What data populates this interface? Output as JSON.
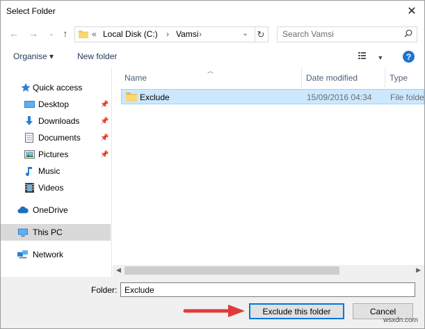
{
  "window": {
    "title": "Select Folder"
  },
  "address": {
    "prefix": "«",
    "crumbs": [
      "Local Disk (C:)",
      "Vamsi"
    ],
    "separator": "›"
  },
  "search": {
    "placeholder": "Search Vamsi"
  },
  "toolbar": {
    "organise": "Organise ▾",
    "new_folder": "New folder"
  },
  "nav": {
    "quick_access": "Quick access",
    "desktop": "Desktop",
    "downloads": "Downloads",
    "documents": "Documents",
    "pictures": "Pictures",
    "music": "Music",
    "videos": "Videos",
    "onedrive": "OneDrive",
    "this_pc": "This PC",
    "network": "Network"
  },
  "columns": {
    "name": "Name",
    "date": "Date modified",
    "type": "Type"
  },
  "files": [
    {
      "name": "Exclude",
      "date": "15/09/2016 04:34",
      "type": "File folder"
    }
  ],
  "bottom": {
    "folder_label": "Folder:",
    "folder_value": "Exclude",
    "confirm": "Exclude this folder",
    "cancel": "Cancel"
  },
  "watermark": "wsxdn.com",
  "colors": {
    "accent": "#0078d7",
    "selection": "#cce8ff",
    "arrow": "#e03b3b",
    "folder": "#f3c453"
  }
}
